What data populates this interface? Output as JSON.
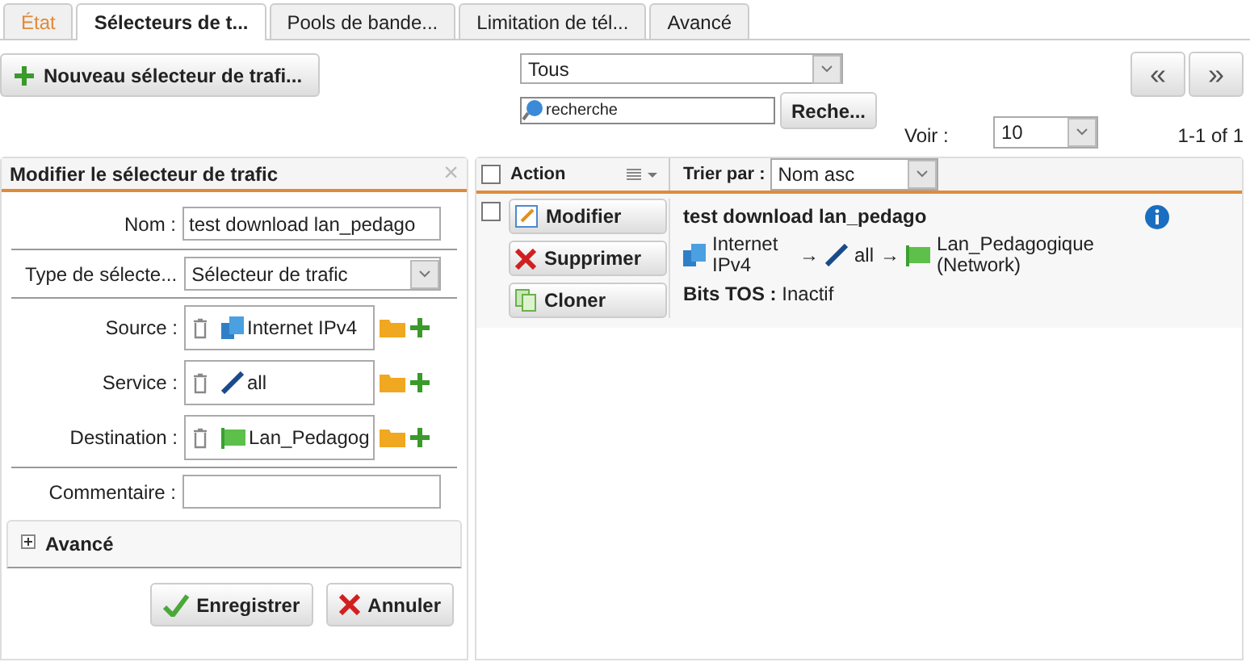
{
  "tabs": [
    {
      "label": "État",
      "selected": false,
      "kind": "status"
    },
    {
      "label": "Sélecteurs de t...",
      "selected": true,
      "kind": "normal"
    },
    {
      "label": "Pools de bande...",
      "selected": false,
      "kind": "normal"
    },
    {
      "label": "Limitation de tél...",
      "selected": false,
      "kind": "normal"
    },
    {
      "label": "Avancé",
      "selected": false,
      "kind": "normal"
    }
  ],
  "toolbar": {
    "new_button": "Nouveau sélecteur de trafi...",
    "filter": "Tous",
    "search": {
      "placeholder": "recherche"
    },
    "search_button": "Reche...",
    "prev": "«",
    "next": "»",
    "view_label": "Voir :",
    "view_value": "10",
    "range": "1-1 of 1"
  },
  "editor": {
    "title": "Modifier le sélecteur de trafic",
    "close": "×",
    "fields": [
      {
        "kind": "text",
        "label": "Nom :",
        "value": "test download lan_pedago"
      },
      {
        "kind": "select",
        "label": "Type de sélecte...",
        "value": "Sélecteur de trafic"
      },
      {
        "kind": "object",
        "label": "Source :",
        "value": "Internet IPv4"
      },
      {
        "kind": "object",
        "label": "Service :",
        "value": "all"
      },
      {
        "kind": "object",
        "label": "Destination :",
        "value": "Lan_Pedagog"
      },
      {
        "kind": "text",
        "label": "Commentaire :"
      }
    ],
    "advanced": {
      "label": "Avancé",
      "expanded": false
    },
    "save": "Enregistrer",
    "cancel": "Annuler"
  },
  "list": {
    "all_checked": false,
    "action_header": "Action",
    "sort_label": "Trier par :",
    "sort_value": "Nom asc",
    "rows": [
      {
        "checked": false,
        "actions": [
          "Modifier",
          "Supprimer",
          "Cloner"
        ],
        "name": "test download lan_pedago",
        "source": "Internet IPv4",
        "arrow1": "→",
        "service": "all",
        "arrow2": "→",
        "destination": "Lan_Pedagogique (Network)",
        "tos_label": "Bits TOS :",
        "tos_value": "Inactif"
      }
    ]
  }
}
